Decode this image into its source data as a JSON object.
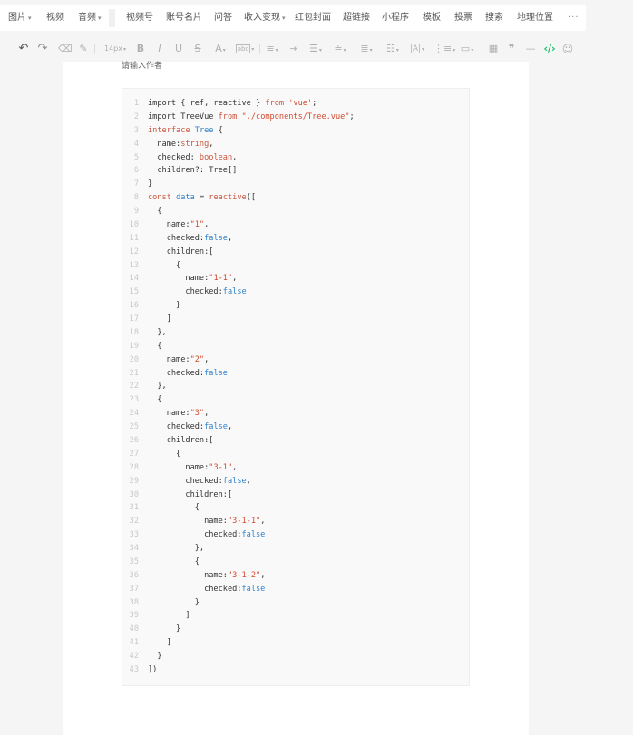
{
  "insert_toolbar": {
    "items": [
      {
        "label": "图片",
        "caret": true
      },
      {
        "label": "视频",
        "caret": false
      },
      {
        "label": "音频",
        "caret": true
      },
      {
        "label": "视频号",
        "caret": false
      },
      {
        "label": "账号名片",
        "caret": false
      },
      {
        "label": "问答",
        "caret": false
      },
      {
        "label": "收入变现",
        "caret": true
      },
      {
        "label": "红包封面",
        "caret": false
      },
      {
        "label": "超链接",
        "caret": false
      },
      {
        "label": "小程序",
        "caret": false
      },
      {
        "label": "模板",
        "caret": false
      },
      {
        "label": "投票",
        "caret": false
      },
      {
        "label": "搜索",
        "caret": false
      },
      {
        "label": "地理位置",
        "caret": false
      }
    ],
    "more_label": "···"
  },
  "format_toolbar": {
    "undo": "↶",
    "redo": "↷",
    "clear": "⌫",
    "brush": "✎",
    "font_size": "14px",
    "bold": "B",
    "italic": "I",
    "underline": "U",
    "strike": "S",
    "font_color": "A",
    "bg_color": "abc",
    "code_icon": "‹/›",
    "emoji": "☺"
  },
  "editor": {
    "author_placeholder": "请输入作者",
    "code_lines": [
      [
        [
          "import { ref, reactive } ",
          "p"
        ],
        [
          "from",
          "k"
        ],
        [
          " ",
          "p"
        ],
        [
          "'vue'",
          "s"
        ],
        [
          ";",
          "p"
        ]
      ],
      [
        [
          "import TreeVue ",
          "p"
        ],
        [
          "from",
          "k"
        ],
        [
          " ",
          "p"
        ],
        [
          "\"./components/Tree.vue\"",
          "s"
        ],
        [
          ";",
          "p"
        ]
      ],
      [
        [
          "interface",
          "k"
        ],
        [
          " ",
          "p"
        ],
        [
          "Tree",
          "b"
        ],
        [
          " {",
          "p"
        ]
      ],
      [
        [
          "  name:",
          "p"
        ],
        [
          "string",
          "k"
        ],
        [
          ",",
          "p"
        ]
      ],
      [
        [
          "  checked: ",
          "p"
        ],
        [
          "boolean",
          "k"
        ],
        [
          ",",
          "p"
        ]
      ],
      [
        [
          "  children?: Tree[]",
          "p"
        ]
      ],
      [
        [
          "}",
          "p"
        ]
      ],
      [
        [
          "const",
          "k"
        ],
        [
          " ",
          "p"
        ],
        [
          "data",
          "b"
        ],
        [
          " = ",
          "p"
        ],
        [
          "reactive",
          "k"
        ],
        [
          "([",
          "p"
        ]
      ],
      [
        [
          "  {",
          "p"
        ]
      ],
      [
        [
          "    name:",
          "p"
        ],
        [
          "\"1\"",
          "s"
        ],
        [
          ",",
          "p"
        ]
      ],
      [
        [
          "    checked:",
          "p"
        ],
        [
          "false",
          "b"
        ],
        [
          ",",
          "p"
        ]
      ],
      [
        [
          "    children:[",
          "p"
        ]
      ],
      [
        [
          "      {",
          "p"
        ]
      ],
      [
        [
          "        name:",
          "p"
        ],
        [
          "\"1-1\"",
          "s"
        ],
        [
          ",",
          "p"
        ]
      ],
      [
        [
          "        checked:",
          "p"
        ],
        [
          "false",
          "b"
        ]
      ],
      [
        [
          "      }",
          "p"
        ]
      ],
      [
        [
          "    ]",
          "p"
        ]
      ],
      [
        [
          "  },",
          "p"
        ]
      ],
      [
        [
          "  {",
          "p"
        ]
      ],
      [
        [
          "    name:",
          "p"
        ],
        [
          "\"2\"",
          "s"
        ],
        [
          ",",
          "p"
        ]
      ],
      [
        [
          "    checked:",
          "p"
        ],
        [
          "false",
          "b"
        ]
      ],
      [
        [
          "  },",
          "p"
        ]
      ],
      [
        [
          "  {",
          "p"
        ]
      ],
      [
        [
          "    name:",
          "p"
        ],
        [
          "\"3\"",
          "s"
        ],
        [
          ",",
          "p"
        ]
      ],
      [
        [
          "    checked:",
          "p"
        ],
        [
          "false",
          "b"
        ],
        [
          ",",
          "p"
        ]
      ],
      [
        [
          "    children:[",
          "p"
        ]
      ],
      [
        [
          "      {",
          "p"
        ]
      ],
      [
        [
          "        name:",
          "p"
        ],
        [
          "\"3-1\"",
          "s"
        ],
        [
          ",",
          "p"
        ]
      ],
      [
        [
          "        checked:",
          "p"
        ],
        [
          "false",
          "b"
        ],
        [
          ",",
          "p"
        ]
      ],
      [
        [
          "        children:[",
          "p"
        ]
      ],
      [
        [
          "          {",
          "p"
        ]
      ],
      [
        [
          "            name:",
          "p"
        ],
        [
          "\"3-1-1\"",
          "s"
        ],
        [
          ",",
          "p"
        ]
      ],
      [
        [
          "            checked:",
          "p"
        ],
        [
          "false",
          "b"
        ]
      ],
      [
        [
          "          },",
          "p"
        ]
      ],
      [
        [
          "          {",
          "p"
        ]
      ],
      [
        [
          "            name:",
          "p"
        ],
        [
          "\"3-1-2\"",
          "s"
        ],
        [
          ",",
          "p"
        ]
      ],
      [
        [
          "            checked:",
          "p"
        ],
        [
          "false",
          "b"
        ]
      ],
      [
        [
          "          }",
          "p"
        ]
      ],
      [
        [
          "        ]",
          "p"
        ]
      ],
      [
        [
          "      }",
          "p"
        ]
      ],
      [
        [
          "    ]",
          "p"
        ]
      ],
      [
        [
          "  }",
          "p"
        ]
      ],
      [
        [
          "])",
          "p"
        ]
      ]
    ]
  }
}
